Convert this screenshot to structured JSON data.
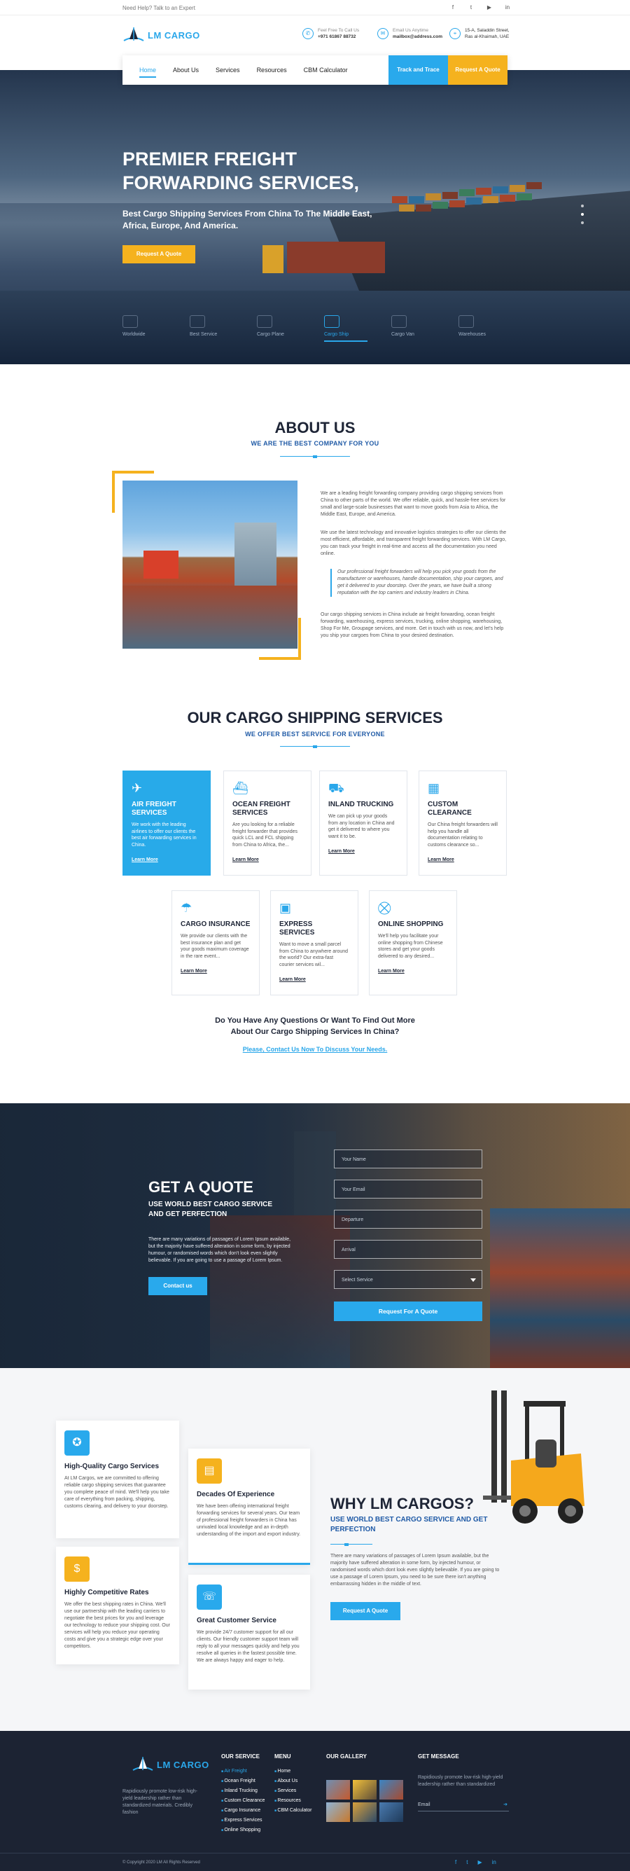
{
  "topbar": {
    "help": "Need Help? Talk to an Expert",
    "social": [
      "f",
      "t",
      "▶",
      "in"
    ]
  },
  "brand": {
    "name": "LM CARGO"
  },
  "header_info": [
    {
      "icon": "phone-icon",
      "line1": "Feel Free To Call Us",
      "line2": "+971 61867 88732"
    },
    {
      "icon": "mail-icon",
      "line1": "Email Us Anytime",
      "line2": "mailbox@address.com"
    },
    {
      "icon": "location-icon",
      "line1": "15-A, Saladdin Street,",
      "line2": "Ras al-Khaimah, UAE"
    }
  ],
  "nav": {
    "items": [
      "Home",
      "About Us",
      "Services",
      "Resources",
      "CBM Calculator"
    ],
    "track": "Track and Trace",
    "quote": "Request A Quote"
  },
  "hero": {
    "title": "PREMIER FREIGHT FORWARDING SERVICES,",
    "subtitle": "Best Cargo Shipping Services From China To The Middle East, Africa, Europe, And America.",
    "button": "Request A Quote",
    "tabs": [
      "Worldwide",
      "Best Service",
      "Cargo Plane",
      "Cargo Ship",
      "Cargo Van",
      "Warehouses"
    ],
    "active_tab": 3
  },
  "about": {
    "title": "ABOUT US",
    "subtitle": "WE ARE THE BEST COMPANY FOR YOU",
    "p1": "We are a leading freight forwarding company providing cargo shipping services from China to other parts of the world. We offer reliable, quick, and hassle-free services for small and large-scale businesses that want to move goods from Asia to Africa, the Middle East, Europe, and America.",
    "p2": "We use the latest technology and innovative logistics strategies to offer our clients the most efficient, affordable, and transparent freight forwarding services. With LM Cargo, you can track your freight in real-time and access all the documentation you need online.",
    "quote": "Our professional freight forwarders will help you pick your goods from the manufacturer or warehouses, handle documentation, ship your cargoes, and get it delivered to your doorstep. Over the years, we have built a strong reputation with the top carriers and industry leaders in China.",
    "p3": "Our cargo shipping services in China include air freight forwarding, ocean freight forwarding, warehousing, express services, trucking, online shopping, warehousing, Shop For Me, Groupage services, and more. Get in touch with us now, and let's help you ship your cargoes from China to your desired destination."
  },
  "services": {
    "title": "OUR CARGO SHIPPING SERVICES",
    "subtitle": "WE OFFER BEST SERVICE FOR EVERYONE",
    "learn_more": "Learn More",
    "cards": [
      {
        "icon": "plane-icon",
        "title": "AIR FREIGHT SERVICES",
        "text": "We work with the leading airlines to offer our clients the best air forwarding services in China."
      },
      {
        "icon": "ship-icon",
        "title": "OCEAN FREIGHT SERVICES",
        "text": "Are you looking for a reliable freight forwarder that provides quick LCL and FCL shipping from China to Africa, the..."
      },
      {
        "icon": "truck-icon",
        "title": "INLAND TRUCKING",
        "text": "We can pick up your goods from any location in China and get it delivered to where you want it to be."
      },
      {
        "icon": "customs-icon",
        "title": "CUSTOM CLEARANCE",
        "text": "Our China freight forwarders will help you handle all documentation relating to customs clearance so..."
      },
      {
        "icon": "umbrella-icon",
        "title": "CARGO INSURANCE",
        "text": "We provide our clients with the best insurance plan and get your goods maximum coverage in the rare event..."
      },
      {
        "icon": "box-icon",
        "title": "EXPRESS SERVICES",
        "text": "Want to move a small parcel from China to anywhere around the world? Our extra-fast courier services wil..."
      },
      {
        "icon": "cart-icon",
        "title": "ONLINE SHOPPING",
        "text": "We'll help you facilitate your online shopping from Chinese stores and get your goods delivered to any desired..."
      }
    ],
    "question": "Do You Have Any Questions Or Want To Find Out More About Our Cargo Shipping Services In China?",
    "contact_link": "Please, Contact Us Now To Discuss Your Needs."
  },
  "quote": {
    "title": "GET A QUOTE",
    "subtitle": "USE WORLD BEST CARGO SERVICE AND GET PERFECTION",
    "text": "There are many variations of passages of Lorem Ipsum available, but the majority have suffered alteration in some form, by injected humour, or randomised words which don't look even slightly believable. If you are going to use a passage of Lorem Ipsum.",
    "contact_btn": "Contact us",
    "fields": {
      "name": "Your Name",
      "email": "Your Email",
      "departure": "Departure",
      "arrival": "Arrival",
      "service": "Select Service"
    },
    "submit": "Request For A Quote"
  },
  "why": {
    "title": "WHY LM CARGOS?",
    "subtitle": "USE WORLD BEST CARGO SERVICE AND GET PERFECTION",
    "text": "There are many variations of passages of Lorem Ipsum available, but the majority have suffered alteration in some form, by injected humour, or randomised words which dont look even slightly believable. If you are going to use a passage of Lorem Ipsum, you need to be sure there isn't anything embarrassing hidden in the middle of text.",
    "button": "Request A Quote",
    "cards": [
      {
        "icon": "badge-icon",
        "title": "High-Quality Cargo Services",
        "text": "At LM Cargos, we are committed to offering reliable cargo shipping services that guarantee you complete peace of mind. We'll help you take care of everything from packing, shipping, customs clearing, and delivery to your doorstep."
      },
      {
        "icon": "calendar-icon",
        "title": "Decades Of Experience",
        "text": "We have been offering international freight forwarding services for several years. Our team of professional freight forwarders in China has unrivaled local knowledge and an in-depth understanding of the import and export industry."
      },
      {
        "icon": "dollar-icon",
        "title": "Highly Competitive Rates",
        "text": "We offer the best shipping rates in China. We'll use our partnership with the leading carriers to negotiate the best prices for you and leverage our technology to reduce your shipping cost. Our services will help you reduce your operating costs and give you a strategic edge over your competitors."
      },
      {
        "icon": "headset-icon",
        "title": "Great Customer Service",
        "text": "We provide 24/7 customer support for all our clients. Our friendly customer support team will reply to all your messages quickly and help you resolve all queries in the fastest possible time. We are always happy and eager to help."
      }
    ]
  },
  "footer": {
    "desc": "Rapidiously promote low-risk high-yield leadership rather than standardized materials. Credibly fashion",
    "our_service_title": "OUR SERVICE",
    "our_service": [
      "Air Freight",
      "Ocean Freight",
      "Inland Trucking",
      "Custom Clearance",
      "Cargo Insurance",
      "Express Services",
      "Online Shopping"
    ],
    "menu_title": "MENU",
    "menu": [
      "Home",
      "About Us",
      "Services",
      "Resources",
      "CBM Calculator"
    ],
    "gallery_title": "OUR GALLERY",
    "message_title": "GET MESSAGE",
    "message_text": "Rapidiously promote low-risk high-yield leadership rather than standardized",
    "email_placeholder": "Email",
    "copyright": "© Copyright 2020 LM All Rights Reserved",
    "social": [
      "f",
      "t",
      "▶",
      "in"
    ]
  }
}
